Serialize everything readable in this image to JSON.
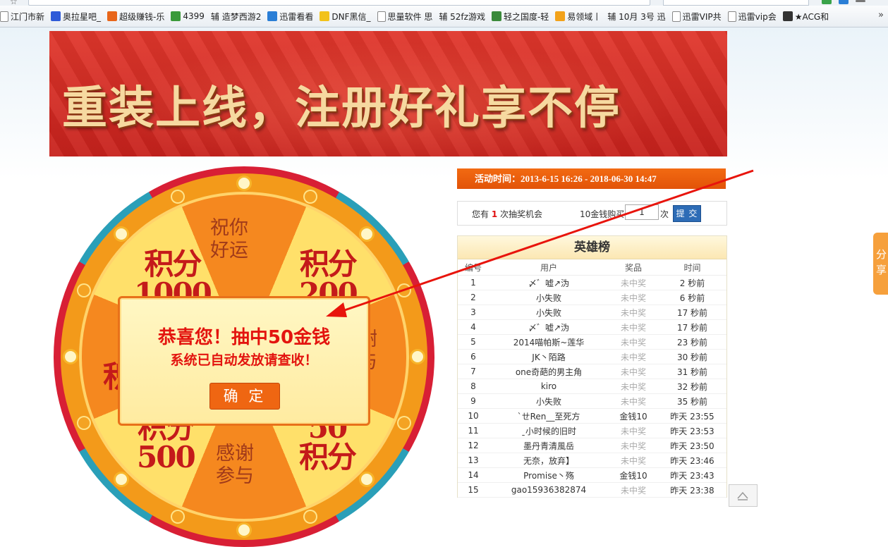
{
  "browser": {
    "bookmarks": [
      {
        "label": "江门市新",
        "icon": "page",
        "color": "#ffffff"
      },
      {
        "label": "奥拉星吧_",
        "icon": "baidu-paw",
        "color": "#2f5bd8"
      },
      {
        "label": "超级赚钱-乐",
        "icon": "grid-logo",
        "color": "#e8661a"
      },
      {
        "label": "4399",
        "icon": "4399-logo",
        "color": "#3a9a3a"
      },
      {
        "label": "辅 造梦西游2",
        "icon": "none",
        "color": ""
      },
      {
        "label": "迅雷看看",
        "icon": "shield-logo",
        "color": "#2a7ed6"
      },
      {
        "label": "DNF黑信_",
        "icon": "fish-logo",
        "color": "#f2c21a"
      },
      {
        "label": "思量软件 思",
        "icon": "page",
        "color": "#ffffff"
      },
      {
        "label": "辅 52fz游戏",
        "icon": "none",
        "color": ""
      },
      {
        "label": "轻之国度-轻",
        "icon": "gear-logo",
        "color": "#3b8a3b"
      },
      {
        "label": "易领域丨",
        "icon": "a-logo",
        "color": "#f2a21a"
      },
      {
        "label": "辅 10月 3号 迅",
        "icon": "none",
        "color": ""
      },
      {
        "label": "迅雷VIP共",
        "icon": "page",
        "color": "#ffffff"
      },
      {
        "label": "迅雷vip会",
        "icon": "page",
        "color": "#ffffff"
      },
      {
        "label": "★ACG和",
        "icon": "cat-logo",
        "color": "#333333"
      }
    ],
    "more_label": "»"
  },
  "banner": {
    "headline": "重装上线，注册好礼享不停"
  },
  "wheel": {
    "segments": [
      {
        "text": "祝你\n好运"
      },
      {
        "text": "积分\n200"
      },
      {
        "text": "谢\n与"
      },
      {
        "text": "50\n积分"
      },
      {
        "text": "感谢\n参与"
      },
      {
        "text": "积分\n500"
      },
      {
        "text": "积"
      },
      {
        "text": "积分\n1000"
      }
    ]
  },
  "popup": {
    "title": "恭喜您！抽中50金钱",
    "subtitle": "系统已自动发放请查收！",
    "confirm_label": "确 定"
  },
  "activity": {
    "label": "活动时间：2013-6-15 16:26 - 2018-06-30 14:47"
  },
  "draw": {
    "prefix": "您有",
    "count": "1",
    "suffix": "次抽奖机会",
    "buy_label": "10金钱购买",
    "buy_value": "1",
    "unit": "次",
    "submit_label": "提 交"
  },
  "leaderboard": {
    "title": "英雄榜",
    "columns": [
      "编号",
      "用户",
      "奖品",
      "时间"
    ],
    "rows": [
      {
        "num": "1",
        "user": "〆゛嘘↗沩",
        "prize": "未中奖",
        "time": "2 秒前"
      },
      {
        "num": "2",
        "user": "小失败",
        "prize": "未中奖",
        "time": "6 秒前"
      },
      {
        "num": "3",
        "user": "小失败",
        "prize": "未中奖",
        "time": "17 秒前"
      },
      {
        "num": "4",
        "user": "〆゛嘘↗沩",
        "prize": "未中奖",
        "time": "17 秒前"
      },
      {
        "num": "5",
        "user": "2014喵帕斯~莲华",
        "prize": "未中奖",
        "time": "23 秒前"
      },
      {
        "num": "6",
        "user": "JK丶陌路",
        "prize": "未中奖",
        "time": "30 秒前"
      },
      {
        "num": "7",
        "user": "one奇葩的男主角",
        "prize": "未中奖",
        "time": "31 秒前"
      },
      {
        "num": "8",
        "user": "kiro",
        "prize": "未中奖",
        "time": "32 秒前"
      },
      {
        "num": "9",
        "user": "小失败",
        "prize": "未中奖",
        "time": "35 秒前"
      },
      {
        "num": "10",
        "user": "`ㄝRen__至死方",
        "prize": "金钱10",
        "time": "昨天 23:55"
      },
      {
        "num": "11",
        "user": "ˍ小时候的旧时",
        "prize": "未中奖",
        "time": "昨天 23:53"
      },
      {
        "num": "12",
        "user": "墨丹青清風岳",
        "prize": "未中奖",
        "time": "昨天 23:50"
      },
      {
        "num": "13",
        "user": "无奈，放弃】",
        "prize": "未中奖",
        "time": "昨天 23:46"
      },
      {
        "num": "14",
        "user": "Promise丶殇",
        "prize": "金钱10",
        "time": "昨天 23:43"
      },
      {
        "num": "15",
        "user": "gao15936382874",
        "prize": "未中奖",
        "time": "昨天 23:38"
      }
    ]
  },
  "share_tab": {
    "label": "分享"
  },
  "colors": {
    "accent": "#ef6612",
    "alert_red": "#e3140f",
    "button_blue": "#2d6cb6"
  }
}
